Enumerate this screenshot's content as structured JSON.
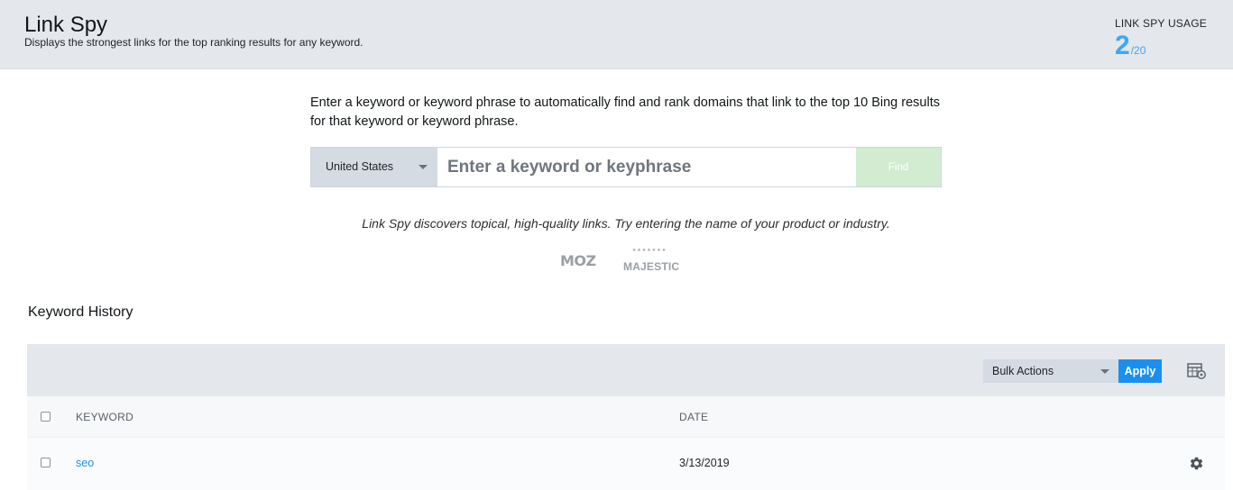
{
  "header": {
    "title": "Link Spy",
    "subtitle": "Displays the strongest links for the top ranking results for any keyword.",
    "usage_label": "LINK SPY USAGE",
    "usage_used": "2",
    "usage_total": "/20"
  },
  "search": {
    "intro": "Enter a keyword or keyword phrase to automatically find and rank domains that link to the top 10 Bing results for that keyword or keyword phrase.",
    "country": "United States",
    "placeholder": "Enter a keyword or keyphrase",
    "value": "",
    "find_label": "Find",
    "tip": "Link Spy discovers topical, high-quality links. Try entering the name of your product or industry."
  },
  "logos": {
    "moz": "MOZ",
    "majestic": "MAJESTIC"
  },
  "history": {
    "title": "Keyword History",
    "bulk_actions": "Bulk Actions",
    "apply_label": "Apply",
    "columns": [
      "KEYWORD",
      "DATE"
    ],
    "rows": [
      {
        "keyword": "seo",
        "date": "3/13/2019"
      }
    ]
  },
  "colors": {
    "accent": "#1a8ff0",
    "usage": "#3fa6f4",
    "find_disabled": "#d1ecd1",
    "header_bg": "#e4e7ec"
  },
  "icons": {
    "country_dropdown": "chevron-down-icon",
    "bulk_dropdown": "chevron-down-icon",
    "table_settings": "table-settings-icon",
    "row_settings": "gear-icon"
  }
}
